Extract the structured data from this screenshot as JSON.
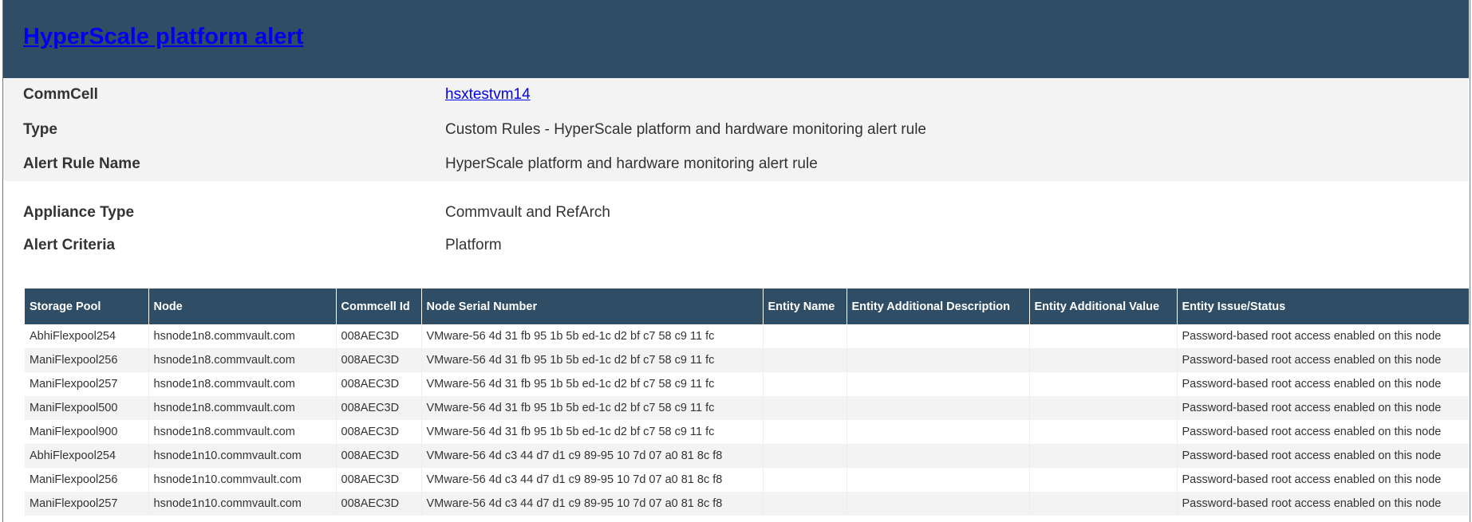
{
  "header": {
    "title": "HyperScale platform alert"
  },
  "details": [
    {
      "label": "CommCell",
      "value": "hsxtestvm14",
      "link": true
    },
    {
      "label": "Type",
      "value": "Custom Rules - HyperScale platform and hardware monitoring alert rule"
    },
    {
      "label": "Alert Rule Name",
      "value": "HyperScale platform and hardware monitoring alert rule"
    },
    {
      "label": "Appliance Type",
      "value": "Commvault and RefArch"
    },
    {
      "label": "Alert Criteria",
      "value": "Platform"
    }
  ],
  "table": {
    "columns": [
      "Storage Pool",
      "Node",
      "Commcell Id",
      "Node Serial Number",
      "Entity Name",
      "Entity Additional Description",
      "Entity Additional Value",
      "Entity Issue/Status"
    ],
    "rows": [
      [
        "AbhiFlexpool254",
        "hsnode1n8.commvault.com",
        "008AEC3D",
        "VMware-56 4d 31 fb 95 1b 5b ed-1c d2 bf c7 58 c9 11 fc",
        "",
        "",
        "",
        "Password-based root access enabled on this node"
      ],
      [
        "ManiFlexpool256",
        "hsnode1n8.commvault.com",
        "008AEC3D",
        "VMware-56 4d 31 fb 95 1b 5b ed-1c d2 bf c7 58 c9 11 fc",
        "",
        "",
        "",
        "Password-based root access enabled on this node"
      ],
      [
        "ManiFlexpool257",
        "hsnode1n8.commvault.com",
        "008AEC3D",
        "VMware-56 4d 31 fb 95 1b 5b ed-1c d2 bf c7 58 c9 11 fc",
        "",
        "",
        "",
        "Password-based root access enabled on this node"
      ],
      [
        "ManiFlexpool500",
        "hsnode1n8.commvault.com",
        "008AEC3D",
        "VMware-56 4d 31 fb 95 1b 5b ed-1c d2 bf c7 58 c9 11 fc",
        "",
        "",
        "",
        "Password-based root access enabled on this node"
      ],
      [
        "ManiFlexpool900",
        "hsnode1n8.commvault.com",
        "008AEC3D",
        "VMware-56 4d 31 fb 95 1b 5b ed-1c d2 bf c7 58 c9 11 fc",
        "",
        "",
        "",
        "Password-based root access enabled on this node"
      ],
      [
        "AbhiFlexpool254",
        "hsnode1n10.commvault.com",
        "008AEC3D",
        "VMware-56 4d c3 44 d7 d1 c9 89-95 10 7d 07 a0 81 8c f8",
        "",
        "",
        "",
        "Password-based root access enabled on this node"
      ],
      [
        "ManiFlexpool256",
        "hsnode1n10.commvault.com",
        "008AEC3D",
        "VMware-56 4d c3 44 d7 d1 c9 89-95 10 7d 07 a0 81 8c f8",
        "",
        "",
        "",
        "Password-based root access enabled on this node"
      ],
      [
        "ManiFlexpool257",
        "hsnode1n10.commvault.com",
        "008AEC3D",
        "VMware-56 4d c3 44 d7 d1 c9 89-95 10 7d 07 a0 81 8c f8",
        "",
        "",
        "",
        "Password-based root access enabled on this node"
      ]
    ]
  }
}
